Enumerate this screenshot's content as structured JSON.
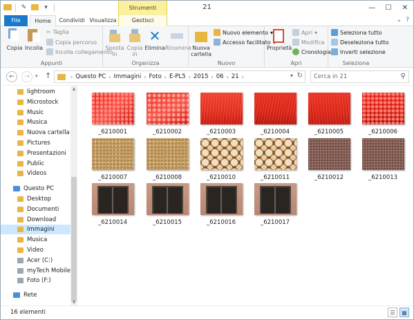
{
  "window": {
    "title": "21",
    "contextual_tab_header": "Strumenti immagini",
    "controls": {
      "minimize": "—",
      "maximize": "☐",
      "close": "✕"
    }
  },
  "tabs": {
    "file": "File",
    "home": "Home",
    "share": "Condividi",
    "view": "Visualizza",
    "manage": "Gestisci"
  },
  "ribbon": {
    "clipboard": {
      "label": "Appunti",
      "copy": "Copia",
      "paste": "Incolla",
      "cut": "Taglia",
      "copy_path": "Copia percorso",
      "paste_shortcut": "Incolla collegamento"
    },
    "organize": {
      "label": "Organizza",
      "move_to": "Sposta in",
      "copy_to": "Copia in",
      "delete": "Elimina",
      "rename": "Rinomina"
    },
    "new": {
      "label": "Nuovo",
      "new_folder": "Nuova cartella",
      "new_item": "Nuovo elemento",
      "easy_access": "Accesso facilitato"
    },
    "open": {
      "label": "Apri",
      "properties": "Proprietà",
      "open": "Apri",
      "edit": "Modifica",
      "history": "Cronologia"
    },
    "select": {
      "label": "Seleziona",
      "select_all": "Seleziona tutto",
      "select_none": "Deseleziona tutto",
      "invert": "Inverti selezione"
    }
  },
  "address": {
    "breadcrumbs": [
      "Questo PC",
      "Immagini",
      "Foto",
      "E-PL5",
      "2015",
      "06",
      "21"
    ],
    "search_placeholder": "Cerca in 21"
  },
  "nav_pane": {
    "folders": [
      "lightroom",
      "Microstock",
      "Music",
      "Musica",
      "Nuova cartella",
      "Pictures",
      "Presentazioni",
      "Public",
      "Videos"
    ],
    "this_pc": "Questo PC",
    "pc_items": [
      "Desktop",
      "Documenti",
      "Download",
      "Immagini",
      "Musica",
      "Video",
      "Acer (C:)",
      "myTech Mobile D",
      "Foto (F:)"
    ],
    "network": "Rete"
  },
  "files": [
    {
      "name": "_6210001",
      "style": "red1"
    },
    {
      "name": "_6210002",
      "style": "red2"
    },
    {
      "name": "_6210003",
      "style": "red3"
    },
    {
      "name": "_6210004",
      "style": "red4"
    },
    {
      "name": "_6210005",
      "style": "red5"
    },
    {
      "name": "_6210006",
      "style": "red6"
    },
    {
      "name": "_6210007",
      "style": "sponge"
    },
    {
      "name": "_6210008",
      "style": "sponge"
    },
    {
      "name": "_6210010",
      "style": "wood"
    },
    {
      "name": "_6210011",
      "style": "wood"
    },
    {
      "name": "_6210012",
      "style": "tile"
    },
    {
      "name": "_6210013",
      "style": "tile"
    },
    {
      "name": "_6210014",
      "style": "oven"
    },
    {
      "name": "_6210015",
      "style": "oven"
    },
    {
      "name": "_6210016",
      "style": "oven"
    },
    {
      "name": "_6210017",
      "style": "oven"
    }
  ],
  "status": {
    "count": "16 elementi"
  }
}
